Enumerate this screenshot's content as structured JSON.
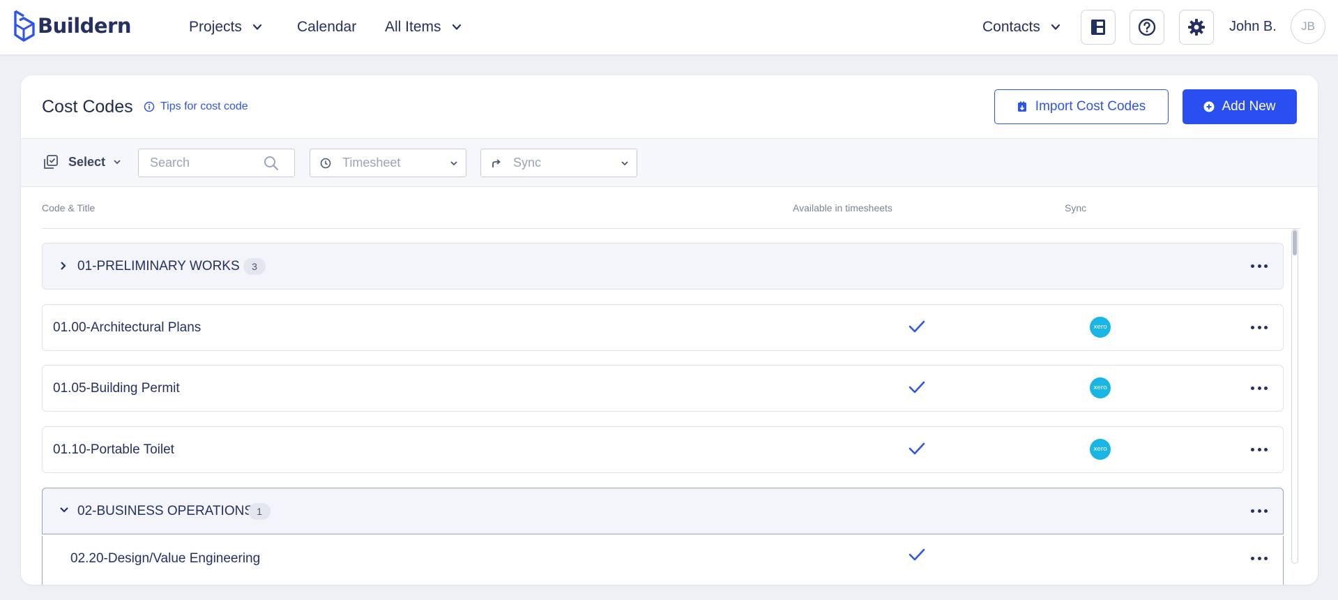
{
  "app": {
    "name": "Buildern"
  },
  "nav": {
    "projects": "Projects",
    "calendar": "Calendar",
    "all_items": "All Items",
    "contacts": "Contacts",
    "user_name": "John B.",
    "avatar_initials": "JB"
  },
  "page": {
    "title": "Cost Codes",
    "tips": "Tips for cost code",
    "import_button": "Import Cost Codes",
    "add_button": "Add New"
  },
  "filters": {
    "select_label": "Select",
    "search_placeholder": "Search",
    "timesheet_placeholder": "Timesheet",
    "sync_placeholder": "Sync"
  },
  "table": {
    "columns": {
      "code_title": "Code & Title",
      "available": "Available in timesheets",
      "sync": "Sync"
    },
    "groups": [
      {
        "title": "01-PRELIMINARY WORKS",
        "count": "3",
        "expanded": false,
        "items": [
          {
            "title": "01.00-Architectural Plans",
            "available": true,
            "sync": "xero"
          },
          {
            "title": "01.05-Building Permit",
            "available": true,
            "sync": "xero"
          },
          {
            "title": "01.10-Portable Toilet",
            "available": true,
            "sync": "xero"
          }
        ]
      },
      {
        "title": "02-BUSINESS OPERATIONS",
        "count": "1",
        "expanded": true,
        "items": [
          {
            "title": "02.20-Design/Value Engineering",
            "available": true,
            "sync": ""
          }
        ]
      }
    ],
    "xero_label": "xero"
  },
  "colors": {
    "accent": "#2a4ff0",
    "navy": "#243063",
    "xero": "#19b5e5"
  },
  "icons": {
    "logo": "buildern-logo-icon",
    "dashboard": "dashboard-icon",
    "help": "help-icon",
    "settings": "gear-icon",
    "tips": "info-icon",
    "import": "import-icon",
    "add": "plus-circle-icon",
    "select": "select-checkbox-icon",
    "search": "search-icon",
    "timesheet": "clock-icon",
    "sync": "share-arrow-icon",
    "check": "check-icon",
    "more": "more-horizontal-icon"
  }
}
